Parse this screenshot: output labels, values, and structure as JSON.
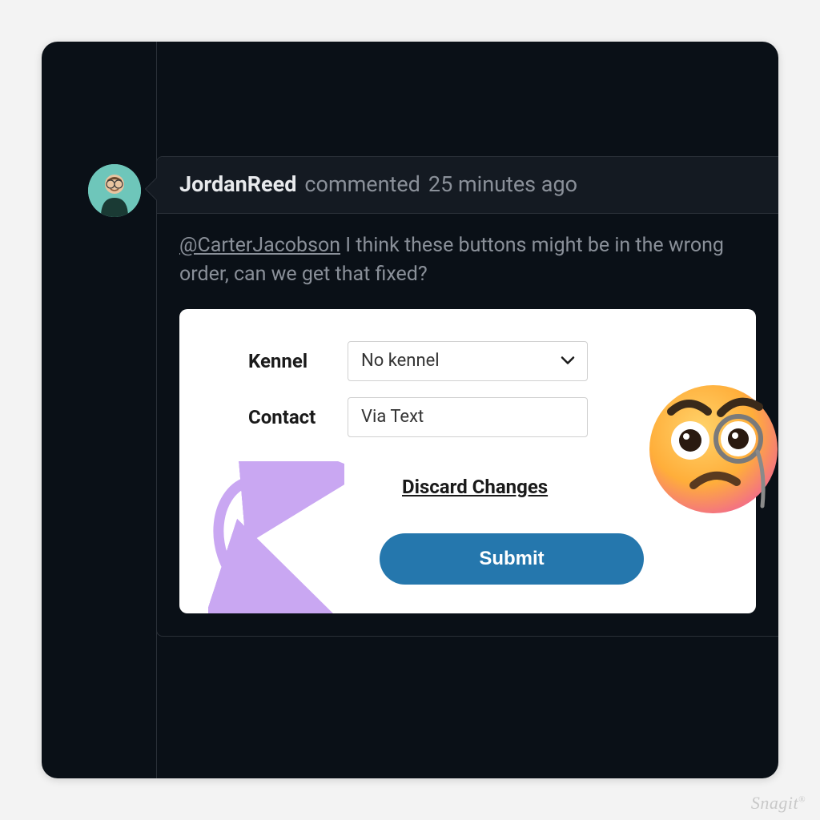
{
  "comment": {
    "author": "JordanReed",
    "action": "commented",
    "timestamp": "25 minutes ago",
    "mention": "@CarterJacobson",
    "body_text": " I think these buttons might be in the wrong order, can we get that fixed?"
  },
  "form": {
    "kennel": {
      "label": "Kennel",
      "value": "No kennel"
    },
    "contact": {
      "label": "Contact",
      "value": "Via Text"
    },
    "discard_label": "Discard Changes",
    "submit_label": "Submit"
  },
  "watermark": "Snagit"
}
